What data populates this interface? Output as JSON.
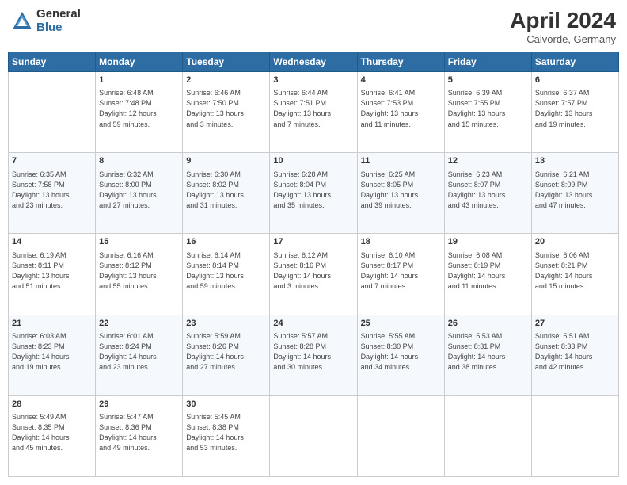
{
  "header": {
    "logo_general": "General",
    "logo_blue": "Blue",
    "month_title": "April 2024",
    "location": "Calvorde, Germany"
  },
  "weekdays": [
    "Sunday",
    "Monday",
    "Tuesday",
    "Wednesday",
    "Thursday",
    "Friday",
    "Saturday"
  ],
  "weeks": [
    [
      {
        "day": "",
        "info": ""
      },
      {
        "day": "1",
        "info": "Sunrise: 6:48 AM\nSunset: 7:48 PM\nDaylight: 12 hours\nand 59 minutes."
      },
      {
        "day": "2",
        "info": "Sunrise: 6:46 AM\nSunset: 7:50 PM\nDaylight: 13 hours\nand 3 minutes."
      },
      {
        "day": "3",
        "info": "Sunrise: 6:44 AM\nSunset: 7:51 PM\nDaylight: 13 hours\nand 7 minutes."
      },
      {
        "day": "4",
        "info": "Sunrise: 6:41 AM\nSunset: 7:53 PM\nDaylight: 13 hours\nand 11 minutes."
      },
      {
        "day": "5",
        "info": "Sunrise: 6:39 AM\nSunset: 7:55 PM\nDaylight: 13 hours\nand 15 minutes."
      },
      {
        "day": "6",
        "info": "Sunrise: 6:37 AM\nSunset: 7:57 PM\nDaylight: 13 hours\nand 19 minutes."
      }
    ],
    [
      {
        "day": "7",
        "info": "Sunrise: 6:35 AM\nSunset: 7:58 PM\nDaylight: 13 hours\nand 23 minutes."
      },
      {
        "day": "8",
        "info": "Sunrise: 6:32 AM\nSunset: 8:00 PM\nDaylight: 13 hours\nand 27 minutes."
      },
      {
        "day": "9",
        "info": "Sunrise: 6:30 AM\nSunset: 8:02 PM\nDaylight: 13 hours\nand 31 minutes."
      },
      {
        "day": "10",
        "info": "Sunrise: 6:28 AM\nSunset: 8:04 PM\nDaylight: 13 hours\nand 35 minutes."
      },
      {
        "day": "11",
        "info": "Sunrise: 6:25 AM\nSunset: 8:05 PM\nDaylight: 13 hours\nand 39 minutes."
      },
      {
        "day": "12",
        "info": "Sunrise: 6:23 AM\nSunset: 8:07 PM\nDaylight: 13 hours\nand 43 minutes."
      },
      {
        "day": "13",
        "info": "Sunrise: 6:21 AM\nSunset: 8:09 PM\nDaylight: 13 hours\nand 47 minutes."
      }
    ],
    [
      {
        "day": "14",
        "info": "Sunrise: 6:19 AM\nSunset: 8:11 PM\nDaylight: 13 hours\nand 51 minutes."
      },
      {
        "day": "15",
        "info": "Sunrise: 6:16 AM\nSunset: 8:12 PM\nDaylight: 13 hours\nand 55 minutes."
      },
      {
        "day": "16",
        "info": "Sunrise: 6:14 AM\nSunset: 8:14 PM\nDaylight: 13 hours\nand 59 minutes."
      },
      {
        "day": "17",
        "info": "Sunrise: 6:12 AM\nSunset: 8:16 PM\nDaylight: 14 hours\nand 3 minutes."
      },
      {
        "day": "18",
        "info": "Sunrise: 6:10 AM\nSunset: 8:17 PM\nDaylight: 14 hours\nand 7 minutes."
      },
      {
        "day": "19",
        "info": "Sunrise: 6:08 AM\nSunset: 8:19 PM\nDaylight: 14 hours\nand 11 minutes."
      },
      {
        "day": "20",
        "info": "Sunrise: 6:06 AM\nSunset: 8:21 PM\nDaylight: 14 hours\nand 15 minutes."
      }
    ],
    [
      {
        "day": "21",
        "info": "Sunrise: 6:03 AM\nSunset: 8:23 PM\nDaylight: 14 hours\nand 19 minutes."
      },
      {
        "day": "22",
        "info": "Sunrise: 6:01 AM\nSunset: 8:24 PM\nDaylight: 14 hours\nand 23 minutes."
      },
      {
        "day": "23",
        "info": "Sunrise: 5:59 AM\nSunset: 8:26 PM\nDaylight: 14 hours\nand 27 minutes."
      },
      {
        "day": "24",
        "info": "Sunrise: 5:57 AM\nSunset: 8:28 PM\nDaylight: 14 hours\nand 30 minutes."
      },
      {
        "day": "25",
        "info": "Sunrise: 5:55 AM\nSunset: 8:30 PM\nDaylight: 14 hours\nand 34 minutes."
      },
      {
        "day": "26",
        "info": "Sunrise: 5:53 AM\nSunset: 8:31 PM\nDaylight: 14 hours\nand 38 minutes."
      },
      {
        "day": "27",
        "info": "Sunrise: 5:51 AM\nSunset: 8:33 PM\nDaylight: 14 hours\nand 42 minutes."
      }
    ],
    [
      {
        "day": "28",
        "info": "Sunrise: 5:49 AM\nSunset: 8:35 PM\nDaylight: 14 hours\nand 45 minutes."
      },
      {
        "day": "29",
        "info": "Sunrise: 5:47 AM\nSunset: 8:36 PM\nDaylight: 14 hours\nand 49 minutes."
      },
      {
        "day": "30",
        "info": "Sunrise: 5:45 AM\nSunset: 8:38 PM\nDaylight: 14 hours\nand 53 minutes."
      },
      {
        "day": "",
        "info": ""
      },
      {
        "day": "",
        "info": ""
      },
      {
        "day": "",
        "info": ""
      },
      {
        "day": "",
        "info": ""
      }
    ]
  ]
}
